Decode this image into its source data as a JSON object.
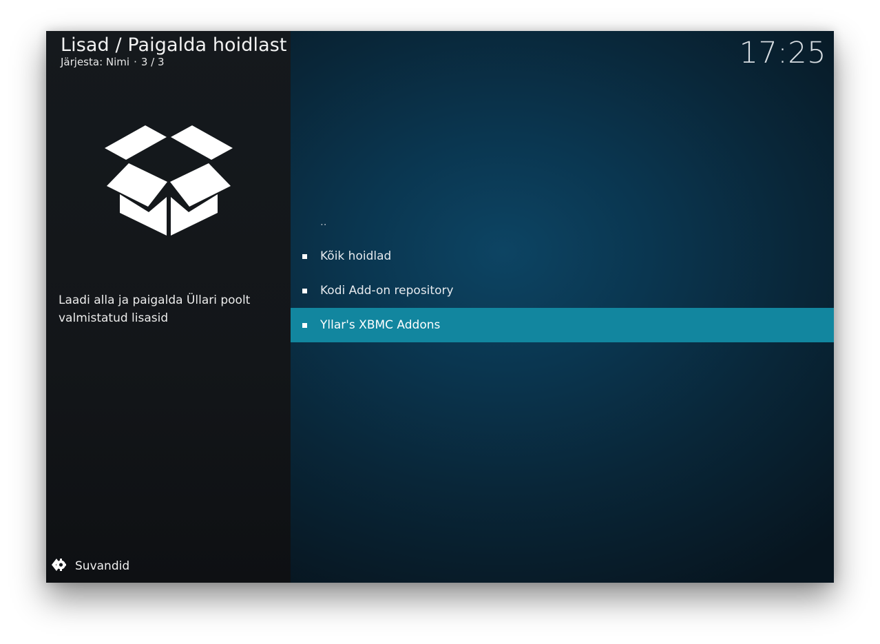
{
  "header": {
    "title": "Lisad / Paigalda hoidlast",
    "sort_label": "Järjesta: Nimi",
    "sort_separator": "·",
    "position": "3 / 3"
  },
  "clock": "17:25",
  "addon": {
    "icon": "open-box-icon",
    "description": "Laadi alla ja paigalda Üllari poolt valmistatud lisasid"
  },
  "list": {
    "items": [
      {
        "label": "..",
        "bullet": false,
        "selected": false
      },
      {
        "label": "Kõik hoidlad",
        "bullet": true,
        "selected": false
      },
      {
        "label": "Kodi Add-on repository",
        "bullet": true,
        "selected": false
      },
      {
        "label": "Yllar's XBMC Addons",
        "bullet": true,
        "selected": true
      }
    ]
  },
  "footer": {
    "options_label": "Suvandid",
    "options_icon": "options-arrow-icon"
  },
  "colors": {
    "selection": "#12869f",
    "sidebar": "#15191d",
    "background": "#0a3650"
  }
}
